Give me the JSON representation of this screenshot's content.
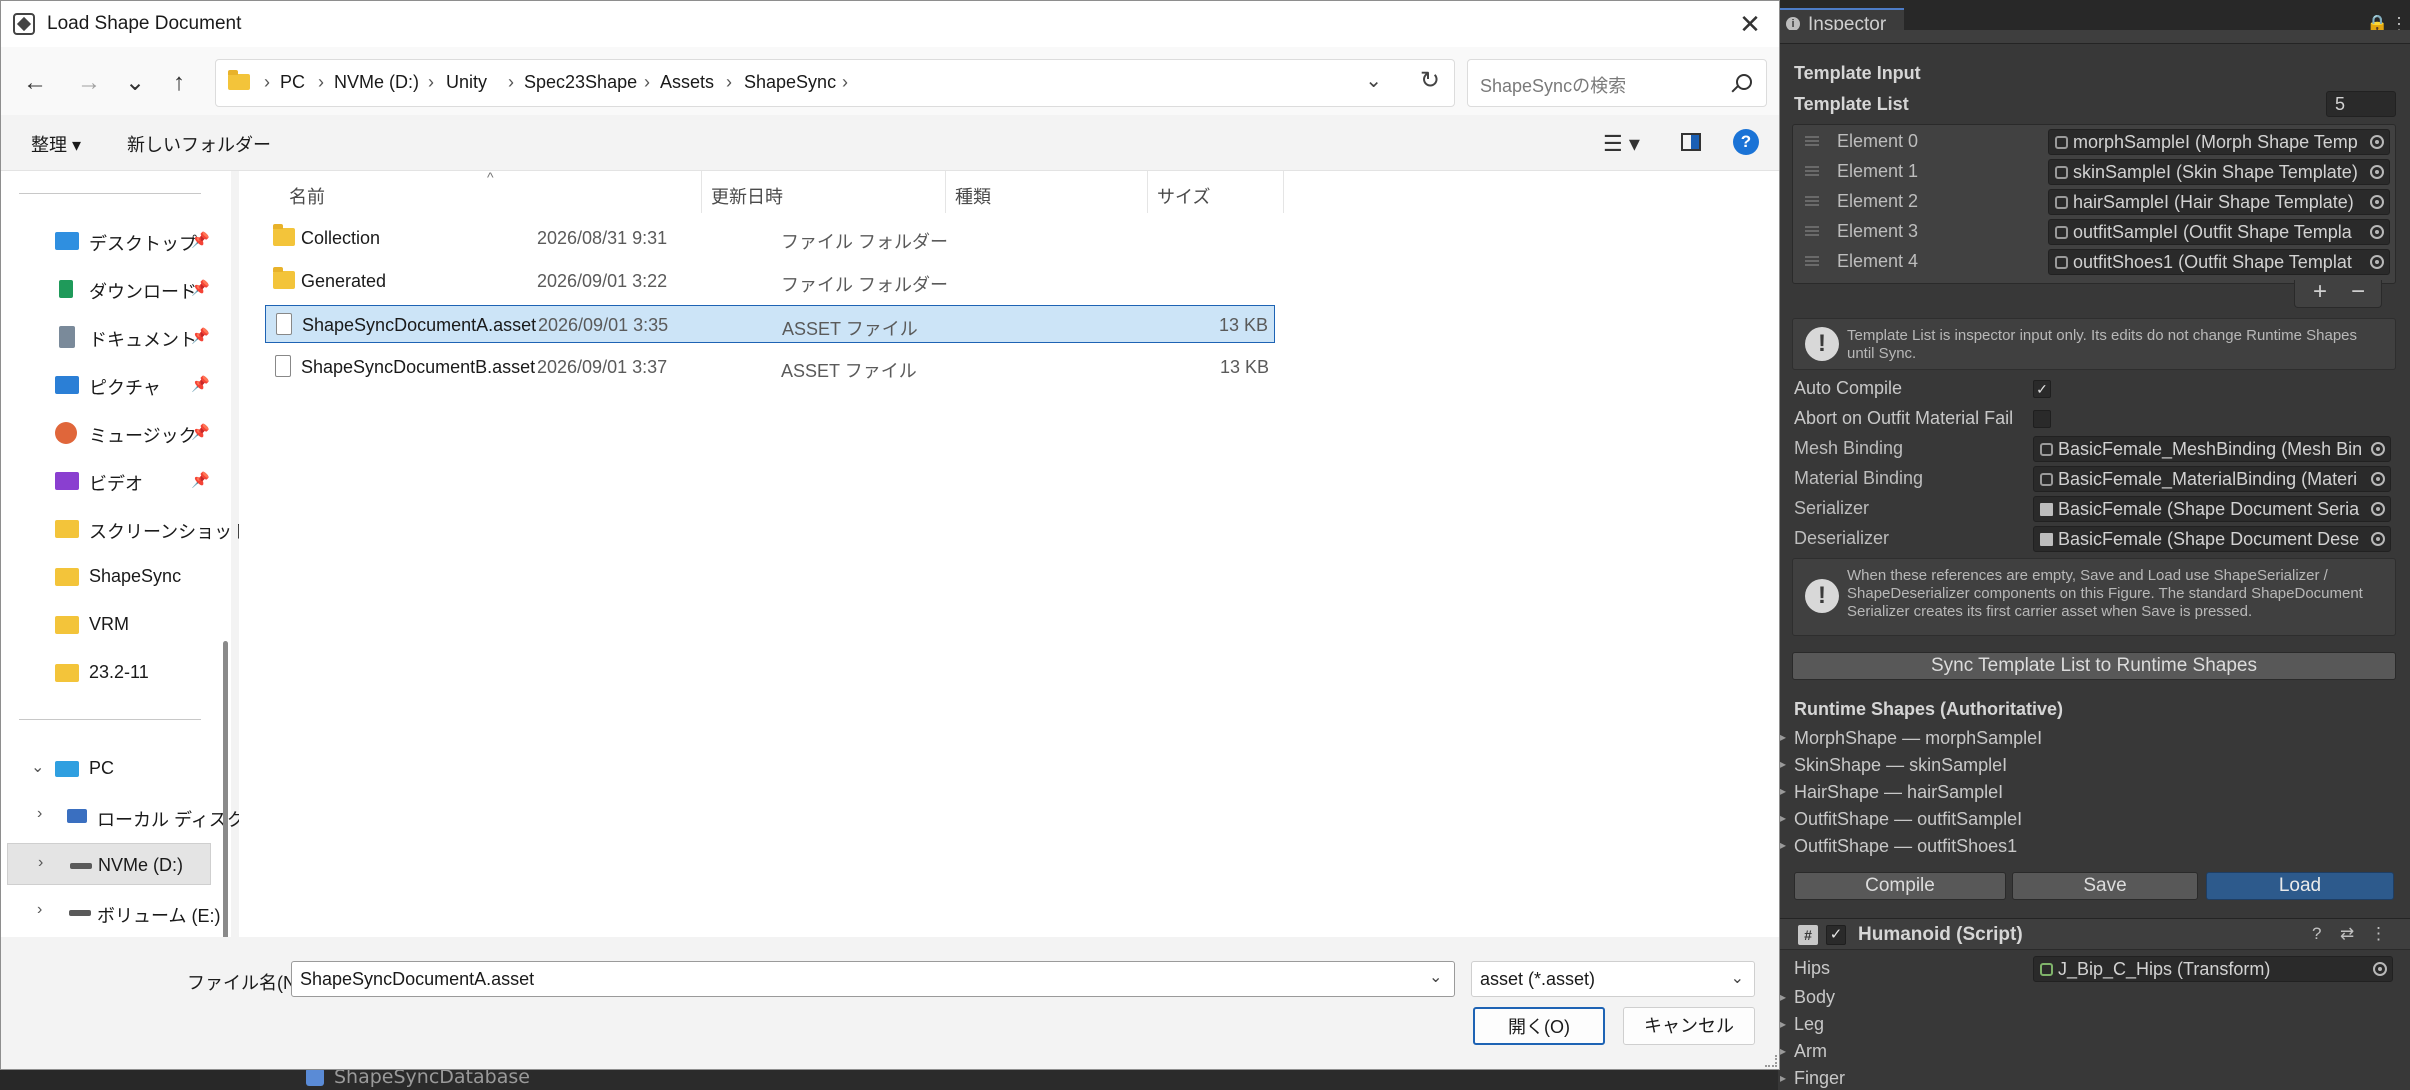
{
  "dialog": {
    "title": "Load Shape Document",
    "close_glyph": "✕",
    "nav": {
      "back": "←",
      "forward": "→",
      "recent": "⌄",
      "up": "↑"
    },
    "breadcrumbs": [
      "PC",
      "NVMe (D:)",
      "Unity",
      "Spec23Shape",
      "Assets",
      "ShapeSync"
    ],
    "breadcrumb_separator": "›",
    "search_placeholder": "ShapeSyncの検索",
    "toolbar": {
      "organize": "整理 ▾",
      "new_folder": "新しいフォルダー",
      "view": "☰ ▾"
    },
    "nav_pane": {
      "quick_access": [
        {
          "label": "デスクトップ",
          "icon": "desktop-icon",
          "color": "#2f8fe0"
        },
        {
          "label": "ダウンロード",
          "icon": "download-icon",
          "color": "#1f9a5a"
        },
        {
          "label": "ドキュメント",
          "icon": "document-icon",
          "color": "#7a8a9a"
        },
        {
          "label": "ピクチャ",
          "icon": "pictures-icon",
          "color": "#2b7fd6"
        },
        {
          "label": "ミュージック",
          "icon": "music-icon",
          "color": "#e0663a"
        },
        {
          "label": "ビデオ",
          "icon": "video-icon",
          "color": "#8a3fd0"
        },
        {
          "label": "スクリーンショット",
          "icon": "folder-icon",
          "color": "#f3c43a"
        },
        {
          "label": "ShapeSync",
          "icon": "folder-icon",
          "color": "#f3c43a"
        },
        {
          "label": "VRM",
          "icon": "folder-icon",
          "color": "#f3c43a"
        },
        {
          "label": "23.2-11",
          "icon": "folder-icon",
          "color": "#f3c43a"
        }
      ],
      "pin_glyph": "📌",
      "pc": {
        "label": "PC",
        "chevron": "⌄"
      },
      "drives": [
        {
          "label": "ローカル ディスク",
          "chevron": "›"
        },
        {
          "label": "NVMe (D:)",
          "chevron": "›",
          "selected": true
        },
        {
          "label": "ボリューム (E:)",
          "chevron": "›"
        }
      ]
    },
    "columns": {
      "name": "名前",
      "date": "更新日時",
      "type": "種類",
      "size": "サイズ"
    },
    "files": [
      {
        "name": "Collection",
        "date": "2026/08/31 9:31",
        "type": "ファイル フォルダー",
        "size": "",
        "kind": "folder"
      },
      {
        "name": "Generated",
        "date": "2026/09/01 3:22",
        "type": "ファイル フォルダー",
        "size": "",
        "kind": "folder"
      },
      {
        "name": "ShapeSyncDocumentA.asset",
        "date": "2026/09/01 3:35",
        "type": "ASSET ファイル",
        "size": "13 KB",
        "kind": "file",
        "selected": true
      },
      {
        "name": "ShapeSyncDocumentB.asset",
        "date": "2026/09/01 3:37",
        "type": "ASSET ファイル",
        "size": "13 KB",
        "kind": "file"
      }
    ],
    "filename_label": "ファイル名(N):",
    "filename_value": "ShapeSyncDocumentA.asset",
    "filetype": "asset (*.asset)",
    "open_button": "開く(O)",
    "cancel_button": "キャンセル"
  },
  "inspector": {
    "tab_label": "Inspector",
    "template_input_label": "Template Input",
    "template_list_label": "Template List",
    "template_list_count": "5",
    "elements": [
      {
        "label": "Element 0",
        "value": "morphSampleI (Morph Shape Temp"
      },
      {
        "label": "Element 1",
        "value": "skinSampleI (Skin Shape Template)"
      },
      {
        "label": "Element 2",
        "value": "hairSampleI (Hair Shape Template)"
      },
      {
        "label": "Element 3",
        "value": "outfitSampleI (Outfit Shape Templa"
      },
      {
        "label": "Element 4",
        "value": "outfitShoes1 (Outfit Shape Templat"
      }
    ],
    "plus": "+",
    "minus": "−",
    "help1": "Template List is inspector input only. Its edits do not change Runtime Shapes until Sync.",
    "auto_compile_label": "Auto Compile",
    "auto_compile_checked": "✓",
    "abort_label": "Abort on Outfit Material Fail",
    "mesh_binding_label": "Mesh Binding",
    "mesh_binding_value": "BasicFemale_MeshBinding (Mesh Bin",
    "material_binding_label": "Material Binding",
    "material_binding_value": "BasicFemale_MaterialBinding (Materi",
    "serializer_label": "Serializer",
    "serializer_value": "BasicFemale (Shape Document Seria",
    "deserializer_label": "Deserializer",
    "deserializer_value": "BasicFemale (Shape Document Dese",
    "help2": "When these references are empty, Save and Load use ShapeSerializer / ShapeDeserializer components on this Figure. The standard ShapeDocument Serializer creates its first carrier asset when Save is pressed.",
    "sync_button": "Sync Template List to Runtime Shapes",
    "runtime_header": "Runtime Shapes (Authoritative)",
    "runtime_shapes": [
      "MorphShape — morphSampleI",
      "SkinShape — skinSampleI",
      "HairShape — hairSampleI",
      "OutfitShape — outfitSampleI",
      "OutfitShape — outfitShoes1"
    ],
    "compile_button": "Compile",
    "save_button": "Save",
    "load_button": "Load",
    "humanoid_title": "Humanoid (Script)",
    "hips_label": "Hips",
    "hips_value": "J_Bip_C_Hips (Transform)",
    "folds": [
      "Body",
      "Leg",
      "Arm",
      "Finger"
    ]
  },
  "background": {
    "hierarchy_item": "ShapeSyncDatabase"
  }
}
